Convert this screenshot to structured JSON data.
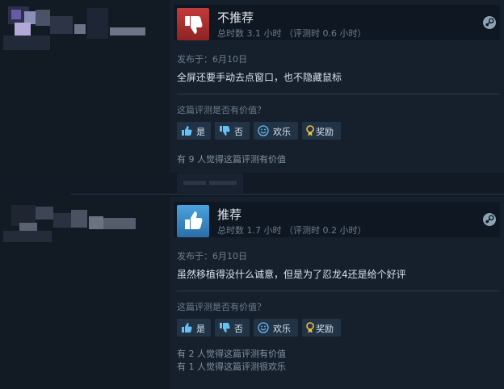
{
  "reviews": [
    {
      "verdict": "不推荐",
      "hours": "总时数 3.1 小时 （评测时 0.6 小时）",
      "posted": "发布于：6月10日",
      "text": "全屏还要手动去点窗口，也不隐藏鼠标",
      "helpful_question": "这篇评测是否有价值？",
      "buttons": {
        "yes": "是",
        "no": "否",
        "funny": "欢乐",
        "award": "奖励"
      },
      "found_helpful": [
        "有 9 人觉得这篇评测有价值"
      ]
    },
    {
      "verdict": "推荐",
      "hours": "总时数 1.7 小时 （评测时 0.2 小时）",
      "posted": "发布于：6月10日",
      "text": "虽然移植得没什么诚意，但是为了忍龙4还是给个好评",
      "helpful_question": "这篇评测是否有价值？",
      "buttons": {
        "yes": "是",
        "no": "否",
        "funny": "欢乐",
        "award": "奖励"
      },
      "found_helpful": [
        "有 2 人觉得这篇评测有价值",
        "有 1 人觉得这篇评测很欢乐"
      ]
    }
  ],
  "colors": {
    "not_recommended": "#c43a3a",
    "recommended": "#4aa3df",
    "background": "#16202d",
    "award_icon": "#f0c040"
  },
  "icons": {
    "thumbs_down": "thumbs-down-icon",
    "thumbs_up": "thumbs-up-icon",
    "steam": "steam-icon",
    "smile": "smile-icon",
    "award": "award-icon"
  }
}
